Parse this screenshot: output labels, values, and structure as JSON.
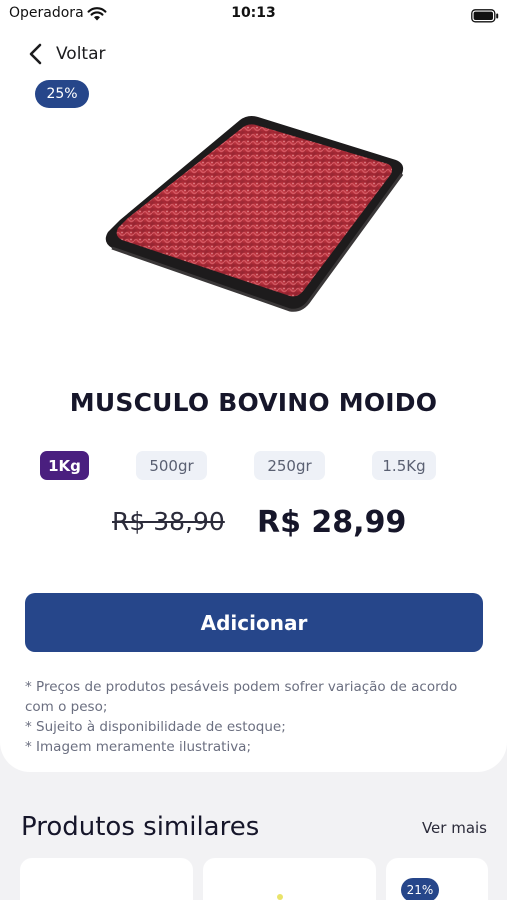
{
  "status_bar": {
    "carrier": "Operadora",
    "time": "10:13"
  },
  "nav": {
    "back_label": "Voltar"
  },
  "product": {
    "discount_badge": "25%",
    "title": "MUSCULO BOVINO MOIDO",
    "weight_options": [
      "1Kg",
      "500gr",
      "250gr",
      "1.5Kg"
    ],
    "selected_weight": "1Kg",
    "old_price": "R$ 38,90",
    "price": "R$ 28,99",
    "add_button_label": "Adicionar",
    "notes": [
      "* Preços de produtos pesáveis podem sofrer variação de acordo com o peso;",
      "* Sujeito à disponibilidade de estoque;",
      "* Imagem meramente ilustrativa;"
    ]
  },
  "similar": {
    "title": "Produtos similares",
    "see_more": "Ver mais",
    "cards": [
      {
        "badge": ""
      },
      {
        "badge": ""
      },
      {
        "badge": "21%"
      }
    ]
  },
  "colors": {
    "primary": "#26468a",
    "chip_active": "#4a1f7f",
    "chip_inactive": "#eef1f7",
    "background": "#f2f2f4"
  }
}
